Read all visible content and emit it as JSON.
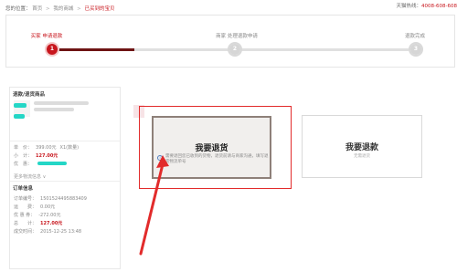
{
  "breadcrumb": {
    "prefix": "您的位置：",
    "items": [
      "首页",
      "我的商城",
      "已买到的宝贝"
    ]
  },
  "hotline": {
    "label": "天猫热线：",
    "number": "4008-608-608"
  },
  "steps": [
    {
      "label": "买家 申请退款",
      "num": "1"
    },
    {
      "label": "商家 处理退款申请",
      "num": "2"
    },
    {
      "label": "退款完成",
      "num": "3"
    }
  ],
  "left": {
    "title": "退款/退货商品",
    "price_label": "单　价：",
    "price_value": "399.00元",
    "qty": "X1(数量)",
    "subtotal_label": "小　计：",
    "subtotal_value": "127.00元",
    "discount_label": "优　惠：",
    "more": "更多物流信息",
    "order_title": "订单信息",
    "order": [
      {
        "label": "订单编号：",
        "value": "150152449588340​9"
      },
      {
        "label": "运　　费：",
        "value": "0.00元"
      },
      {
        "label": "优 惠 券：",
        "value": "-272.00元"
      },
      {
        "label": "总　　计：",
        "value": "127.00元"
      },
      {
        "label": "成交时间：",
        "value": "2015-12-25 13:48"
      }
    ]
  },
  "options": {
    "refund_goods_title": "我要退货",
    "refund_goods_desc": "需要退回您已收到的货物，退货前请与商家沟通，填写退货物流单号",
    "refund_only_title": "我要退款",
    "refund_only_sub": "无需退货"
  }
}
